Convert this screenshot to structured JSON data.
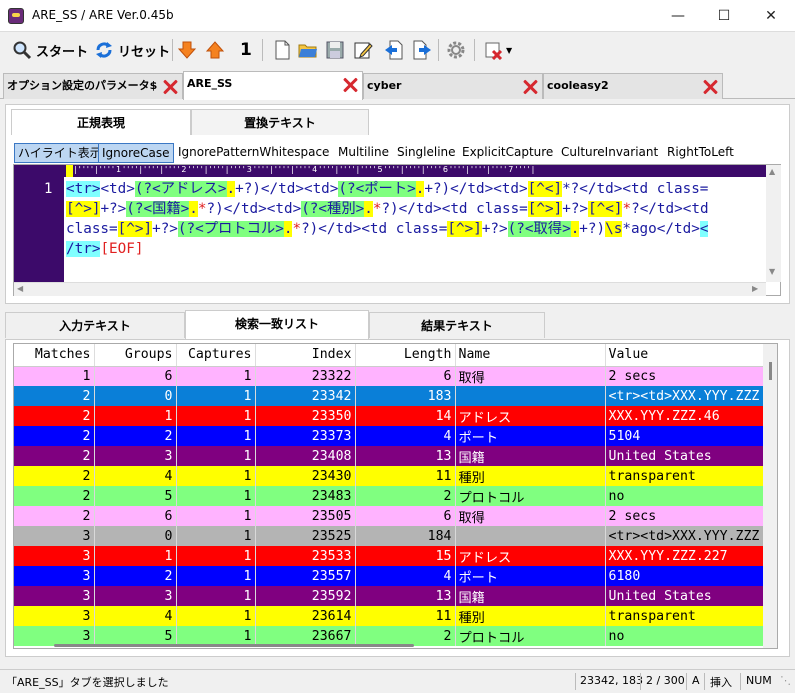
{
  "window": {
    "title": "ARE_SS / ARE Ver.0.45b"
  },
  "toolbar": {
    "start": "スタート",
    "reset": "リセット",
    "counter": "1"
  },
  "doc_tabs": [
    "オプション設定のパラメータ$",
    "ARE_SS",
    "cyber",
    "cooleasy2"
  ],
  "top_tabs": [
    "正規表現",
    "置換テキスト"
  ],
  "options": [
    "ハイライト表示",
    "IgnoreCase",
    "IgnorePatternWhitespace",
    "Multiline",
    "Singleline",
    "ExplicitCapture",
    "CultureInvariant",
    "RightToLeft"
  ],
  "editor": {
    "line_number": "1",
    "ruler": "|''''|''''1''''|''''|''''2''''|''''|''''3''''|''''|''''4''''|''''|''''5''''|''''|''''6''''|''''|''''7''''|"
  },
  "bottom_tabs": [
    "入力テキスト",
    "検索一致リスト",
    "結果テキスト"
  ],
  "columns": [
    "Matches",
    "Groups",
    "Captures",
    "Index",
    "Length",
    "Name",
    "Value"
  ],
  "rows": [
    {
      "m": "1",
      "g": "6",
      "c": "1",
      "i": "23322",
      "l": "6",
      "name": "取得",
      "value": "2 secs",
      "bg": "#ffb3ff",
      "fg": "#000000"
    },
    {
      "m": "2",
      "g": "0",
      "c": "1",
      "i": "23342",
      "l": "183",
      "name": "",
      "value": "<tr><td>XXX.YYY.ZZZ",
      "bg": "#0a7fd8",
      "fg": "#ffffff"
    },
    {
      "m": "2",
      "g": "1",
      "c": "1",
      "i": "23350",
      "l": "14",
      "name": "アドレス",
      "value": "XXX.YYY.ZZZ.46",
      "bg": "#ff0000",
      "fg": "#ffffff"
    },
    {
      "m": "2",
      "g": "2",
      "c": "1",
      "i": "23373",
      "l": "4",
      "name": "ポート",
      "value": "5104",
      "bg": "#0000ff",
      "fg": "#ffffff"
    },
    {
      "m": "2",
      "g": "3",
      "c": "1",
      "i": "23408",
      "l": "13",
      "name": "国籍",
      "value": "United States",
      "bg": "#800080",
      "fg": "#ffffff"
    },
    {
      "m": "2",
      "g": "4",
      "c": "1",
      "i": "23430",
      "l": "11",
      "name": "種別",
      "value": "transparent",
      "bg": "#ffff00",
      "fg": "#000000"
    },
    {
      "m": "2",
      "g": "5",
      "c": "1",
      "i": "23483",
      "l": "2",
      "name": "プロトコル",
      "value": "no",
      "bg": "#80ff80",
      "fg": "#000000"
    },
    {
      "m": "2",
      "g": "6",
      "c": "1",
      "i": "23505",
      "l": "6",
      "name": "取得",
      "value": "2 secs",
      "bg": "#ffb3ff",
      "fg": "#000000"
    },
    {
      "m": "3",
      "g": "0",
      "c": "1",
      "i": "23525",
      "l": "184",
      "name": "",
      "value": "<tr><td>XXX.YYY.ZZZ",
      "bg": "#b4b4b4",
      "fg": "#000000"
    },
    {
      "m": "3",
      "g": "1",
      "c": "1",
      "i": "23533",
      "l": "15",
      "name": "アドレス",
      "value": "XXX.YYY.ZZZ.227",
      "bg": "#ff0000",
      "fg": "#ffffff"
    },
    {
      "m": "3",
      "g": "2",
      "c": "1",
      "i": "23557",
      "l": "4",
      "name": "ポート",
      "value": "6180",
      "bg": "#0000ff",
      "fg": "#ffffff"
    },
    {
      "m": "3",
      "g": "3",
      "c": "1",
      "i": "23592",
      "l": "13",
      "name": "国籍",
      "value": "United States",
      "bg": "#800080",
      "fg": "#ffffff"
    },
    {
      "m": "3",
      "g": "4",
      "c": "1",
      "i": "23614",
      "l": "11",
      "name": "種別",
      "value": "transparent",
      "bg": "#ffff00",
      "fg": "#000000"
    },
    {
      "m": "3",
      "g": "5",
      "c": "1",
      "i": "23667",
      "l": "2",
      "name": "プロトコル",
      "value": "no",
      "bg": "#80ff80",
      "fg": "#000000"
    }
  ],
  "status": {
    "message": "「ARE_SS」タブを選択しました",
    "position": "23342, 183",
    "page": "2 / 300",
    "mode_a": "A",
    "insert": "挿入",
    "num": "NUM"
  }
}
